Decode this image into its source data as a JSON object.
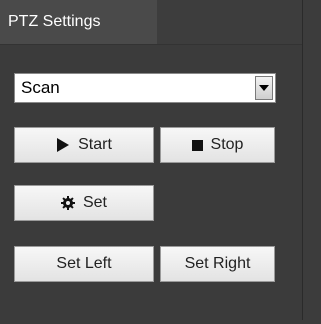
{
  "panel": {
    "title": "PTZ Settings"
  },
  "mode_select": {
    "value": "Scan"
  },
  "buttons": {
    "start": "Start",
    "stop": "Stop",
    "set": "Set",
    "set_left": "Set Left",
    "set_right": "Set Right"
  },
  "icons": {
    "start": "play-icon",
    "stop": "stop-square-icon",
    "set": "gear-icon",
    "dropdown": "chevron-down-icon"
  },
  "colors": {
    "panel_bg": "#3b3b3b",
    "title_tab_bg": "#4a4a4a",
    "title_text": "#ffffff",
    "button_bg": "#efefef",
    "button_text": "#222222"
  }
}
